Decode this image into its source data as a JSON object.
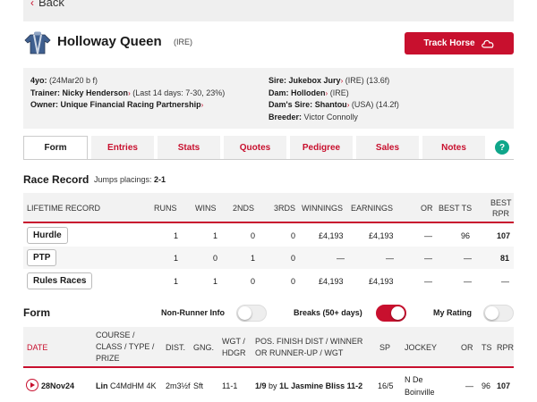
{
  "nav": {
    "back_label": "Back"
  },
  "horse": {
    "name": "Holloway Queen",
    "country": "(IRE)"
  },
  "actions": {
    "track_label": "Track Horse"
  },
  "info": {
    "age_label": "4yo:",
    "age_value": "(24Mar20 b f)",
    "trainer_label": "Trainer:",
    "trainer_name": "Nicky Henderson",
    "trainer_stats": "(Last 14 days: 7-30, 23%)",
    "owner_label": "Owner:",
    "owner_name": "Unique Financial Racing Partnership",
    "sire_label": "Sire:",
    "sire_name": "Jukebox Jury",
    "sire_extra": "(IRE) (13.6f)",
    "dam_label": "Dam:",
    "dam_name": "Holloden",
    "dam_extra": "(IRE)",
    "damsire_label": "Dam's Sire:",
    "damsire_name": "Shantou",
    "damsire_extra": "(USA) (14.2f)",
    "breeder_label": "Breeder:",
    "breeder_name": "Victor Connolly"
  },
  "tabs": [
    {
      "label": "Form"
    },
    {
      "label": "Entries"
    },
    {
      "label": "Stats"
    },
    {
      "label": "Quotes"
    },
    {
      "label": "Pedigree"
    },
    {
      "label": "Sales"
    },
    {
      "label": "Notes"
    }
  ],
  "help_label": "?",
  "race_record": {
    "title": "Race Record",
    "jumps_label": "Jumps placings:",
    "jumps_value": "2-1",
    "headers": {
      "lifetime": "LIFETIME RECORD",
      "runs": "RUNS",
      "wins": "WINS",
      "seconds": "2NDS",
      "thirds": "3RDS",
      "winnings": "WINNINGS",
      "earnings": "EARNINGS",
      "or": "OR",
      "best_ts": "BEST TS",
      "best_rpr_1": "BEST",
      "best_rpr_2": "RPR"
    },
    "rows": [
      {
        "type": "Hurdle",
        "runs": "1",
        "wins": "1",
        "seconds": "0",
        "thirds": "0",
        "winnings": "£4,193",
        "earnings": "£4,193",
        "or": "—",
        "best_ts": "96",
        "best_rpr": "107"
      },
      {
        "type": "PTP",
        "runs": "1",
        "wins": "0",
        "seconds": "1",
        "thirds": "0",
        "winnings": "—",
        "earnings": "—",
        "or": "—",
        "best_ts": "—",
        "best_rpr": "81"
      },
      {
        "type": "Rules Races",
        "runs": "1",
        "wins": "1",
        "seconds": "0",
        "thirds": "0",
        "winnings": "£4,193",
        "earnings": "£4,193",
        "or": "—",
        "best_ts": "—",
        "best_rpr": "—"
      }
    ]
  },
  "form": {
    "title": "Form",
    "toggles": [
      {
        "label": "Non-Runner Info",
        "on": false
      },
      {
        "label": "Breaks (50+ days)",
        "on": true
      },
      {
        "label": "My Rating",
        "on": false
      }
    ],
    "headers": {
      "date": "DATE",
      "course_1": "COURSE /",
      "course_2": "CLASS / TYPE /",
      "course_3": "PRIZE",
      "dist": "DIST.",
      "going": "GNG.",
      "wgt_1": "WGT /",
      "wgt_2": "HDGR",
      "pos_1": "POS. FINISH DIST / WINNER",
      "pos_2": "OR RUNNER-UP / WGT",
      "sp": "SP",
      "jockey": "JOCKEY",
      "or": "OR",
      "ts": "TS",
      "rpr": "RPR"
    },
    "row": {
      "date": "28Nov24",
      "course": "Lin",
      "class": "C4MdHM 4K",
      "dist": "2m3½f",
      "going": "Sft",
      "wgt": "11-1",
      "pos": "1/9",
      "by": "by",
      "margin": "1L",
      "winner": "Jasmine Bliss 11-2",
      "sp": "16/5",
      "jockey_1": "N De",
      "jockey_2": "Boinville",
      "or": "—",
      "ts": "96",
      "rpr": "107"
    }
  },
  "colors": {
    "accent": "#c8102e",
    "help": "#0fa68a",
    "panel": "#f2f2f2"
  }
}
